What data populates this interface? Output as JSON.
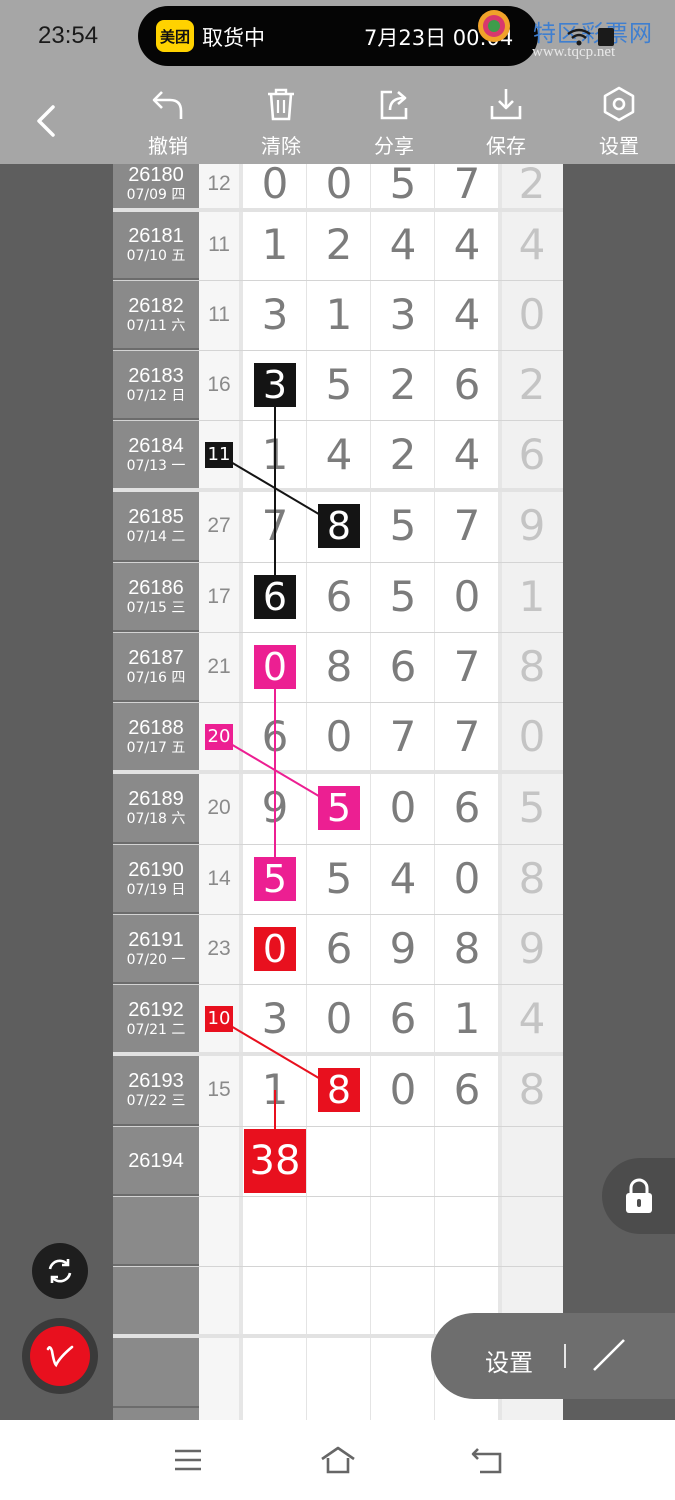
{
  "status_bar": {
    "time": "23:54",
    "notification": {
      "app_logo": "美团",
      "text": "取货中",
      "time": "7月23日 00:04"
    },
    "watermark": {
      "title": "特区彩票网",
      "url": "www.tqcp.net"
    }
  },
  "toolbar": {
    "undo_label": "撤销",
    "clear_label": "清除",
    "share_label": "分享",
    "save_label": "保存",
    "settings_label": "设置"
  },
  "chart": {
    "rows": [
      {
        "period": "26180",
        "date": "07/09 四",
        "sum": "12",
        "digits": [
          "0",
          "0",
          "5",
          "7",
          "2"
        ]
      },
      {
        "period": "26181",
        "date": "07/10 五",
        "sum": "11",
        "digits": [
          "1",
          "2",
          "4",
          "4",
          "4"
        ]
      },
      {
        "period": "26182",
        "date": "07/11 六",
        "sum": "11",
        "digits": [
          "3",
          "1",
          "3",
          "4",
          "0"
        ]
      },
      {
        "period": "26183",
        "date": "07/12 日",
        "sum": "16",
        "digits": [
          "3",
          "5",
          "2",
          "6",
          "2"
        ]
      },
      {
        "period": "26184",
        "date": "07/13 一",
        "sum": "11",
        "digits": [
          "1",
          "4",
          "2",
          "4",
          "6"
        ]
      },
      {
        "period": "26185",
        "date": "07/14 二",
        "sum": "27",
        "digits": [
          "7",
          "8",
          "5",
          "7",
          "9"
        ]
      },
      {
        "period": "26186",
        "date": "07/15 三",
        "sum": "17",
        "digits": [
          "6",
          "6",
          "5",
          "0",
          "1"
        ]
      },
      {
        "period": "26187",
        "date": "07/16 四",
        "sum": "21",
        "digits": [
          "0",
          "8",
          "6",
          "7",
          "8"
        ]
      },
      {
        "period": "26188",
        "date": "07/17 五",
        "sum": "20",
        "digits": [
          "6",
          "0",
          "7",
          "7",
          "0"
        ]
      },
      {
        "period": "26189",
        "date": "07/18 六",
        "sum": "20",
        "digits": [
          "9",
          "5",
          "0",
          "6",
          "5"
        ]
      },
      {
        "period": "26190",
        "date": "07/19 日",
        "sum": "14",
        "digits": [
          "5",
          "5",
          "4",
          "0",
          "8"
        ]
      },
      {
        "period": "26191",
        "date": "07/20 一",
        "sum": "23",
        "digits": [
          "0",
          "6",
          "9",
          "8",
          "9"
        ]
      },
      {
        "period": "26192",
        "date": "07/21 二",
        "sum": "10",
        "digits": [
          "3",
          "0",
          "6",
          "1",
          "4"
        ]
      },
      {
        "period": "26193",
        "date": "07/22 三",
        "sum": "15",
        "digits": [
          "1",
          "8",
          "0",
          "6",
          "8"
        ]
      },
      {
        "period": "26194",
        "date": "",
        "sum": "",
        "digits": [
          "",
          "",
          "",
          "",
          ""
        ]
      },
      {
        "period": "",
        "date": "",
        "sum": "",
        "digits": [
          "",
          "",
          "",
          "",
          ""
        ]
      },
      {
        "period": "",
        "date": "",
        "sum": "",
        "digits": [
          "",
          "",
          "",
          "",
          ""
        ]
      },
      {
        "period": "",
        "date": "",
        "sum": "",
        "digits": [
          "",
          "",
          "",
          "",
          ""
        ]
      }
    ],
    "groups": [
      {
        "color": "#141414",
        "cells": [
          [
            3,
            0,
            "3"
          ],
          [
            5,
            1,
            "8"
          ],
          [
            6,
            0,
            "6"
          ]
        ],
        "sum_badge": [
          4,
          "11"
        ]
      },
      {
        "color": "#ec1f92",
        "cells": [
          [
            7,
            0,
            "0"
          ],
          [
            9,
            1,
            "5"
          ],
          [
            10,
            0,
            "5"
          ]
        ],
        "sum_badge": [
          8,
          "20"
        ]
      },
      {
        "color": "#e8101e",
        "cells": [
          [
            11,
            0,
            "0"
          ],
          [
            13,
            1,
            "8"
          ]
        ],
        "sum_badge": [
          12,
          "10"
        ]
      }
    ],
    "result_badge": {
      "row": 14,
      "col": 0,
      "value": "38",
      "color": "#e8101e"
    }
  },
  "floating": {
    "settings_label": "设置",
    "sync_icon": "sync-icon",
    "pen_icon": "pen-icon",
    "lock_icon": "lock-icon"
  },
  "navbar": {
    "icons": [
      "menu-icon",
      "home-icon",
      "back-icon"
    ]
  }
}
